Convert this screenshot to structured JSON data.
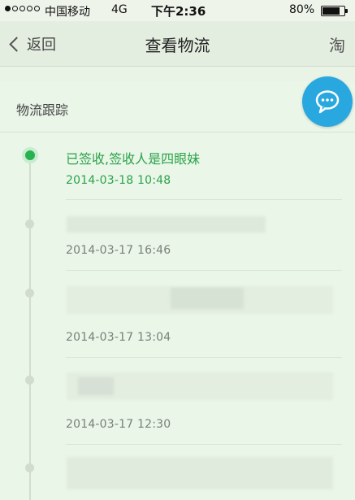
{
  "status_bar": {
    "carrier": "中国移动",
    "network": "4G",
    "time": "下午2:36",
    "battery_percent": "80%",
    "battery_level": 0.8,
    "signal_bars_filled": 1,
    "signal_bars_total": 5
  },
  "nav": {
    "back_label": "返回",
    "title": "查看物流",
    "right_icon_label": "淘"
  },
  "tracking": {
    "section_title": "物流跟踪",
    "events": [
      {
        "description": "已签收,签收人是四眼妹",
        "time": "2014-03-18 10:48",
        "active": true
      },
      {
        "description": "",
        "time": "2014-03-17 16:46",
        "active": false
      },
      {
        "description": "",
        "time": "2014-03-17 13:04",
        "active": false
      },
      {
        "description": "",
        "time": "2014-03-17 12:30",
        "active": false
      }
    ]
  },
  "colors": {
    "accent_green": "#2aa34a",
    "chat_button": "#29a8df",
    "background": "#eaf6e8"
  },
  "icons": {
    "chat": "chat-bubble-icon",
    "back": "chevron-left-icon"
  }
}
